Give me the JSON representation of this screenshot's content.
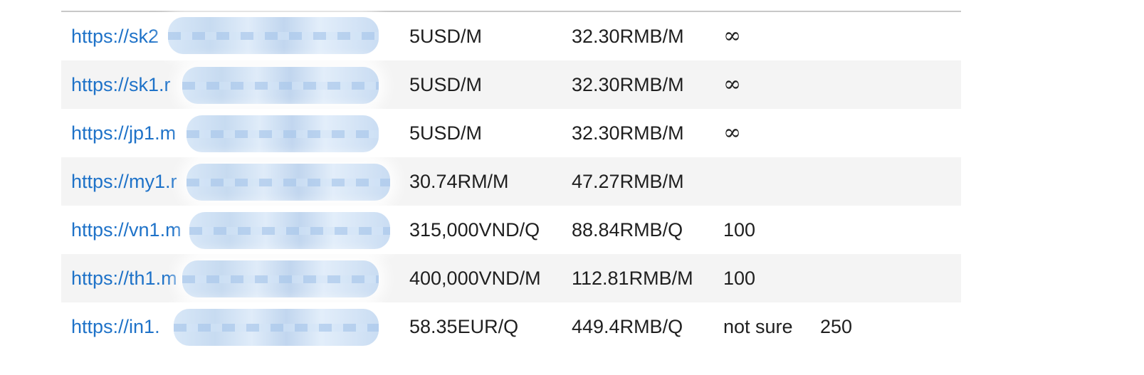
{
  "rows": [
    {
      "url": "https://sk2",
      "price": "5USD/M",
      "rmb": "32.30RMB/M",
      "extra": "∞",
      "extra2": ""
    },
    {
      "url": "https://sk1.r",
      "price": "5USD/M",
      "rmb": "32.30RMB/M",
      "extra": "∞",
      "extra2": ""
    },
    {
      "url": "https://jp1.m",
      "price": "5USD/M",
      "rmb": "32.30RMB/M",
      "extra": "∞",
      "extra2": ""
    },
    {
      "url": "https://my1.r",
      "price": "30.74RM/M",
      "rmb": "47.27RMB/M",
      "extra": "",
      "extra2": ""
    },
    {
      "url": "https://vn1.m",
      "price": "315,000VND/Q",
      "rmb": "88.84RMB/Q",
      "extra": "100",
      "extra2": ""
    },
    {
      "url": "https://th1.m",
      "price": "400,000VND/M",
      "rmb": "112.81RMB/M",
      "extra": "100",
      "extra2": ""
    },
    {
      "url": "https://in1.",
      "price": "58.35EUR/Q",
      "rmb": "449.4RMB/Q",
      "extra": "not sure",
      "extra2": "250"
    }
  ],
  "colors": {
    "link": "#1e72c8",
    "text": "#1f1f1f",
    "row_alt_bg": "#f4f4f4",
    "rule": "#c8c8c8"
  }
}
